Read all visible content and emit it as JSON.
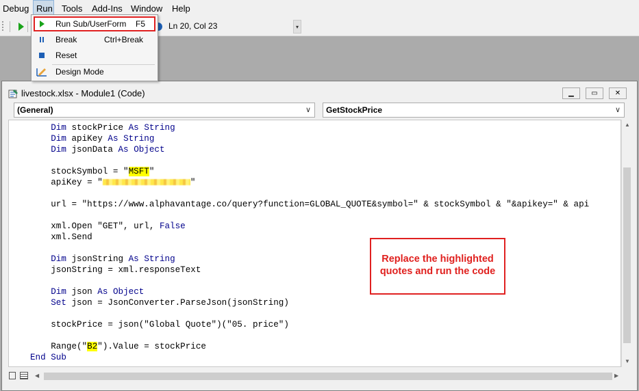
{
  "menubar": {
    "items": [
      "Debug",
      "Run",
      "Tools",
      "Add-Ins",
      "Window",
      "Help"
    ]
  },
  "toolbar": {
    "position": "Ln 20, Col 23"
  },
  "run_menu": {
    "items": [
      {
        "label": "Run Sub/UserForm",
        "shortcut": "F5",
        "icon": "play-icon"
      },
      {
        "label": "Break",
        "shortcut": "Ctrl+Break",
        "icon": "pause-icon"
      },
      {
        "label": "Reset",
        "shortcut": "",
        "icon": "stop-icon"
      },
      {
        "label": "Design Mode",
        "shortcut": "",
        "icon": "design-mode-icon"
      }
    ]
  },
  "window": {
    "title": "livestock.xlsx - Module1 (Code)",
    "object_combo": "(General)",
    "procedure_combo": "GetStockPrice"
  },
  "code": {
    "lines": [
      "    Dim stockPrice As String",
      "    Dim apiKey As String",
      "    Dim jsonData As Object",
      "",
      "    stockSymbol = \"MSFT\"",
      "    apiKey = \"\"",
      "",
      "    url = \"https://www.alphavantage.co/query?function=GLOBAL_QUOTE&symbol=\" & stockSymbol & \"&apikey=\" & api",
      "",
      "    xml.Open \"GET\", url, False",
      "    xml.Send",
      "",
      "    Dim jsonString As String",
      "    jsonString = xml.responseText",
      "",
      "    Dim json As Object",
      "    Set json = JsonConverter.ParseJson(jsonString)",
      "",
      "    stockPrice = json(\"Global Quote\")(\"05. price\")",
      "",
      "    Range(\"B2\").Value = stockPrice",
      "End Sub"
    ],
    "highlighted": [
      "MSFT",
      "B2"
    ]
  },
  "annotation": {
    "line1": "Replace the highlighted",
    "line2": "quotes and run the code"
  },
  "colors": {
    "keyword": "#00008b",
    "highlight": "#ffff00",
    "callout": "#e02020"
  }
}
